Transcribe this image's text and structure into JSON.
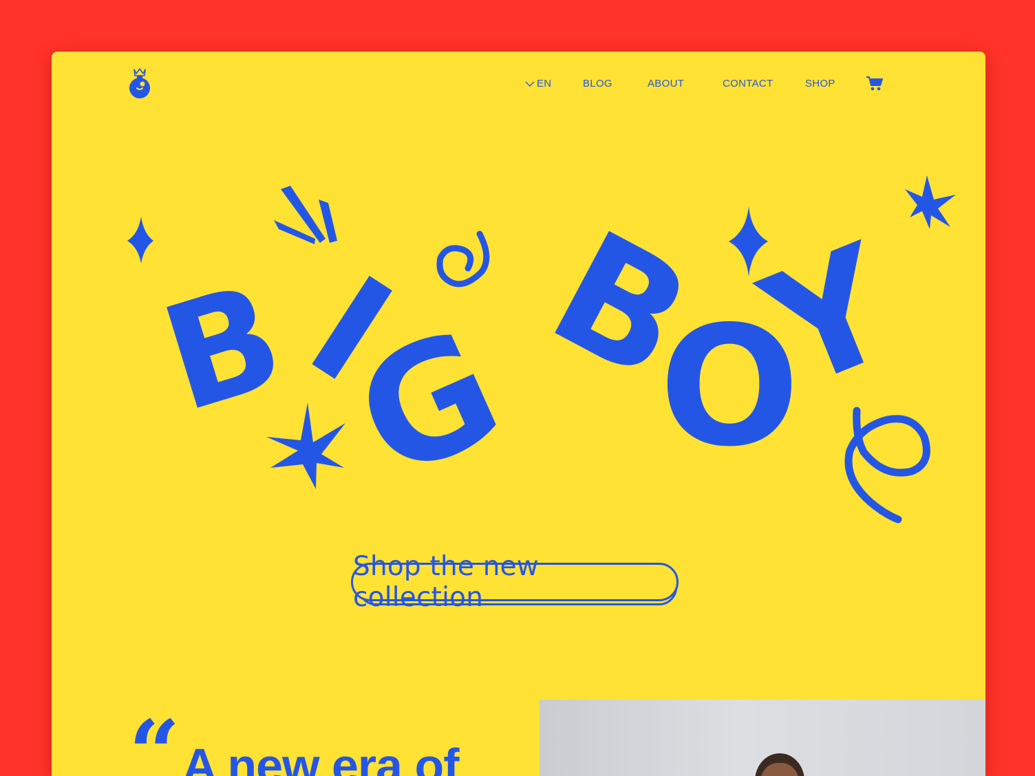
{
  "brand": {
    "name": "",
    "logo_icon": "bomb-logo-icon"
  },
  "nav": {
    "language": "EN",
    "items": [
      "BLOG",
      "ABOUT",
      "CONTACT",
      "SHOP"
    ],
    "cart_icon": "cart-icon"
  },
  "hero": {
    "letters": [
      "B",
      "I",
      "G",
      "B",
      "O",
      "Y"
    ],
    "cta_label": "Shop the new collection"
  },
  "quote": {
    "mark": "“",
    "text": "A new era of"
  },
  "colors": {
    "background": "#ff3329",
    "card": "#ffe234",
    "accent": "#2456e6"
  }
}
